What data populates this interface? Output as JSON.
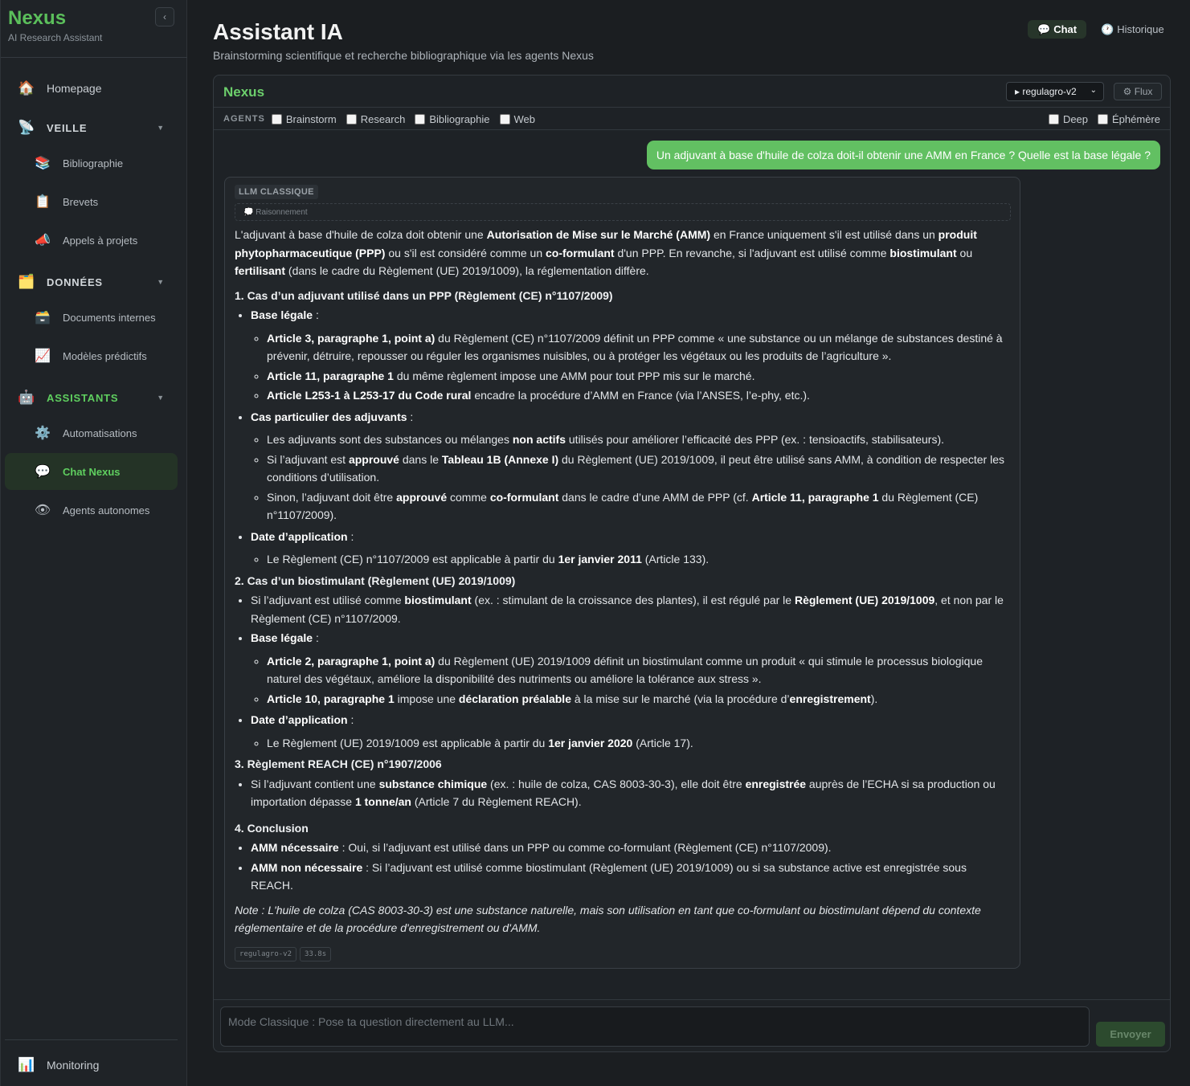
{
  "sidebar": {
    "brand": "Nexus",
    "tagline": "AI Research Assistant",
    "collapse_icon": "‹",
    "items": [
      {
        "label": "Homepage",
        "icon": "🏠"
      },
      {
        "label": "VEILLE",
        "icon": "📡",
        "chev": "▼"
      },
      {
        "label": "Bibliographie",
        "icon": "📚"
      },
      {
        "label": "Brevets",
        "icon": "📋"
      },
      {
        "label": "Appels à projets",
        "icon": "📣"
      },
      {
        "label": "DONNÉES",
        "icon": "🗂️",
        "chev": "▼"
      },
      {
        "label": "Documents internes",
        "icon": "🗃️"
      },
      {
        "label": "Modèles prédictifs",
        "icon": "📈"
      },
      {
        "label": "ASSISTANTS",
        "icon": "🤖",
        "chev": "▼"
      },
      {
        "label": "Automatisations",
        "icon": "⚙️"
      },
      {
        "label": "Chat Nexus",
        "icon": "💬"
      },
      {
        "label": "Agents autonomes",
        "icon": "👁"
      },
      {
        "label": "Monitoring",
        "icon": "📊"
      }
    ]
  },
  "header": {
    "title": "Assistant IA",
    "subtitle": "Brainstorming scientifique et recherche bibliographique via les agents Nexus",
    "tabs": [
      {
        "label": "Chat",
        "icon": "💬"
      },
      {
        "label": "Historique",
        "icon": "🕐"
      }
    ]
  },
  "panel": {
    "title": "Nexus",
    "model": "▸ regulagro-v2",
    "model_caret": "⌄",
    "flux_label": "⚙ Flux",
    "agents_label": "AGENTS",
    "agents": [
      "Brainstorm",
      "Research",
      "Bibliographie",
      "Web"
    ],
    "options": [
      "Deep",
      "Éphémère"
    ]
  },
  "conversation": {
    "user_message": "Un adjuvant à base d'huile de colza doit-il obtenir une AMM en France ? Quelle est la base légale ?",
    "answer_tag": "LLM CLASSIQUE",
    "reasoning_label": "💭 Raisonnement",
    "intro": {
      "t1": "L'adjuvant à base d'huile de colza doit obtenir une ",
      "b1": "Autorisation de Mise sur le Marché (AMM)",
      "t2": " en France uniquement s'il est utilisé dans un ",
      "b2": "produit phytopharmaceutique (PPP)",
      "t3": " ou s'il est considéré comme un ",
      "b3": "co-formulant",
      "t4": " d'un PPP. En revanche, si l'adjuvant est utilisé comme ",
      "b4": "biostimulant",
      "t5": " ou ",
      "b5": "fertilisant",
      "t6": " (dans le cadre du Règlement (UE) 2019/1009), la réglementation diffère."
    },
    "s1": {
      "heading": "1. Cas d’un adjuvant utilisé dans un PPP (Règlement (CE) n°1107/2009)",
      "base_label": "Base légale",
      "base_colon": " :",
      "a1_b": "Article 3, paragraphe 1, point a)",
      "a1_t": " du Règlement (CE) n°1107/2009 définit un PPP comme « une substance ou un mélange de substances destiné à prévenir, détruire, repousser ou réguler les organismes nuisibles, ou à protéger les végétaux ou les produits de l’agriculture ».",
      "a2_b": "Article 11, paragraphe 1",
      "a2_t": " du même règlement impose une AMM pour tout PPP mis sur le marché.",
      "a3_b": "Article L253-1 à L253-17 du Code rural",
      "a3_t": " encadre la procédure d’AMM en France (via l’ANSES, l’e-phy, etc.).",
      "case_label": "Cas particulier des adjuvants",
      "case_colon": " :",
      "c1_t1": "Les adjuvants sont des substances ou mélanges ",
      "c1_b": "non actifs",
      "c1_t2": " utilisés pour améliorer l’efficacité des PPP (ex. : tensioactifs, stabilisateurs).",
      "c2_t1": "Si l’adjuvant est ",
      "c2_b1": "approuvé",
      "c2_t2": " dans le ",
      "c2_b2": "Tableau 1B (Annexe I)",
      "c2_t3": " du Règlement (UE) 2019/1009, il peut être utilisé sans AMM, à condition de respecter les conditions d’utilisation.",
      "c3_t1": "Sinon, l’adjuvant doit être ",
      "c3_b1": "approuvé",
      "c3_t2": " comme ",
      "c3_b2": "co-formulant",
      "c3_t3": " dans le cadre d’une AMM de PPP (cf. ",
      "c3_b3": "Article 11, paragraphe 1",
      "c3_t4": " du Règlement (CE) n°1107/2009).",
      "date_label": "Date d’application",
      "date_colon": " :",
      "d1_t1": "Le Règlement (CE) n°1107/2009 est applicable à partir du ",
      "d1_b": "1er janvier 2011",
      "d1_t2": " (Article 133)."
    },
    "s2": {
      "heading": "2. Cas d’un biostimulant (Règlement (UE) 2019/1009)",
      "i1_t1": "Si l’adjuvant est utilisé comme ",
      "i1_b1": "biostimulant",
      "i1_t2": " (ex. : stimulant de la croissance des plantes), il est régulé par le ",
      "i1_b2": "Règlement (UE) 2019/1009",
      "i1_t3": ", et non par le Règlement (CE) n°1107/2009.",
      "base_label": "Base légale",
      "base_colon": " :",
      "a1_b": "Article 2, paragraphe 1, point a)",
      "a1_t": " du Règlement (UE) 2019/1009 définit un biostimulant comme un produit « qui stimule le processus biologique naturel des végétaux, améliore la disponibilité des nutriments ou améliore la tolérance aux stress ».",
      "a2_b1": "Article 10, paragraphe 1",
      "a2_t1": " impose une ",
      "a2_b2": "déclaration préalable",
      "a2_t2": " à la mise sur le marché (via la procédure d’",
      "a2_b3": "enregistrement",
      "a2_t3": ").",
      "date_label": "Date d’application",
      "date_colon": " :",
      "d1_t1": "Le Règlement (UE) 2019/1009 est applicable à partir du ",
      "d1_b": "1er janvier 2020",
      "d1_t2": " (Article 17)."
    },
    "s3": {
      "heading": "3. Règlement REACH (CE) n°1907/2006",
      "i1_t1": "Si l’adjuvant contient une ",
      "i1_b1": "substance chimique",
      "i1_t2": " (ex. : huile de colza, CAS 8003-30-3), elle doit être ",
      "i1_b2": "enregistrée",
      "i1_t3": " auprès de l’ECHA si sa production ou importation dépasse ",
      "i1_b3": "1 tonne/an",
      "i1_t4": " (Article 7 du Règlement REACH)."
    },
    "s4": {
      "heading": "4. Conclusion",
      "i1_b": "AMM nécessaire",
      "i1_t": " : Oui, si l’adjuvant est utilisé dans un PPP ou comme co-formulant (Règlement (CE) n°1107/2009).",
      "i2_b": "AMM non nécessaire",
      "i2_t": " : Si l’adjuvant est utilisé comme biostimulant (Règlement (UE) 2019/1009) ou si sa substance active est enregistrée sous REACH."
    },
    "note": "Note : L'huile de colza (CAS 8003-30-3) est une substance naturelle, mais son utilisation en tant que co-formulant ou biostimulant dépend du contexte réglementaire et de la procédure d'enregistrement ou d'AMM.",
    "meta": [
      "regulagro-v2",
      "33.8s"
    ]
  },
  "composer": {
    "placeholder": "Mode Classique : Pose ta question directement au LLM...",
    "send_label": "Envoyer"
  },
  "colors": {
    "accent": "#5bbf5b",
    "user_bubble": "#62c062",
    "background": "#1b1e21"
  }
}
